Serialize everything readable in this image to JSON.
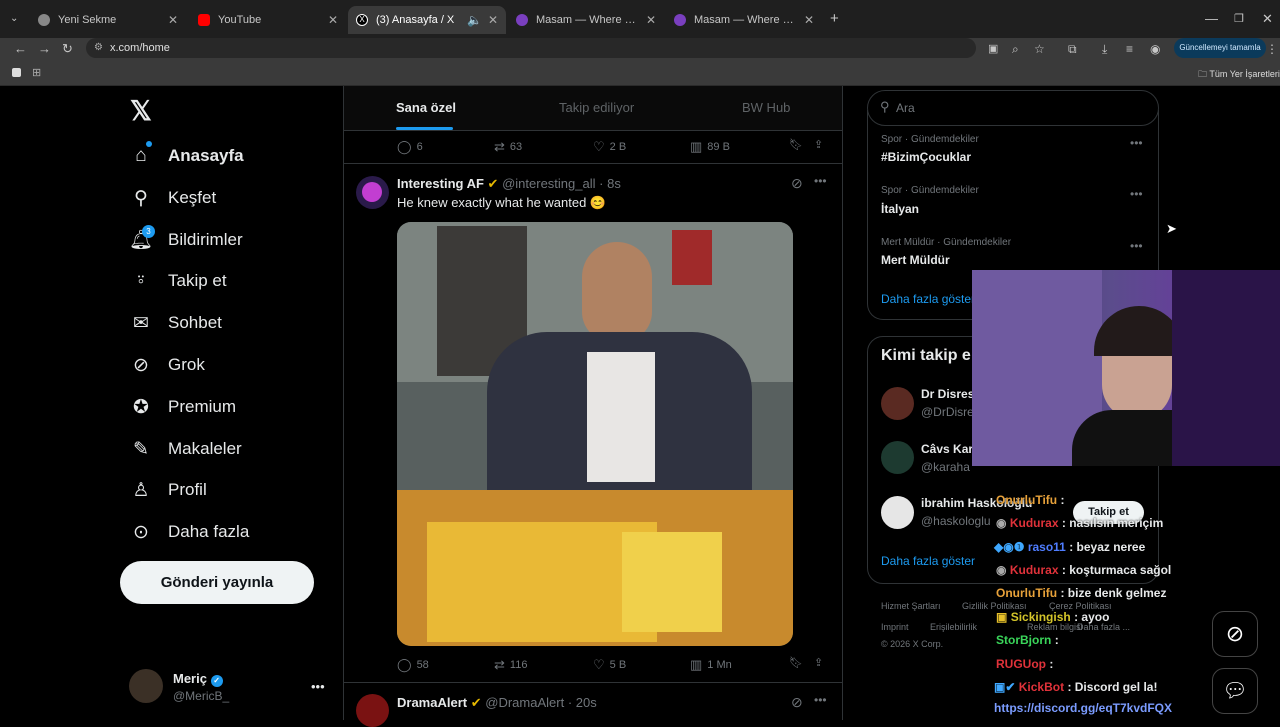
{
  "browser": {
    "tabs": [
      {
        "title": "Yeni Sekme"
      },
      {
        "title": "YouTube"
      },
      {
        "title": "(3) Anasayfa / X"
      },
      {
        "title": "Masam — Where Setups Come..."
      },
      {
        "title": "Masam — Where Setups Come..."
      }
    ],
    "url": "x.com/home",
    "update_label": "Güncellemeyi tamamla",
    "bookmarks_label": "Tüm Yer İşaretleri"
  },
  "nav": {
    "items": [
      {
        "label": "Anasayfa",
        "icon": "home-icon"
      },
      {
        "label": "Keşfet",
        "icon": "search-icon"
      },
      {
        "label": "Bildirimler",
        "icon": "bell-icon"
      },
      {
        "label": "Takip et",
        "icon": "person-add-icon"
      },
      {
        "label": "Sohbet",
        "icon": "mail-icon"
      },
      {
        "label": "Grok",
        "icon": "grok-icon"
      },
      {
        "label": "Premium",
        "icon": "verified-icon"
      },
      {
        "label": "Makaleler",
        "icon": "article-icon"
      },
      {
        "label": "Profil",
        "icon": "profile-icon"
      },
      {
        "label": "Daha fazla",
        "icon": "more-circle-icon"
      }
    ],
    "notif_count": "3",
    "post_label": "Gönderi yayınla",
    "user": {
      "name": "Meriç",
      "handle": "@MericB_"
    }
  },
  "feed": {
    "tabs": [
      "Sana özel",
      "Takip ediliyor",
      "BW Hub"
    ],
    "top_actions": {
      "replies": "6",
      "reposts": "63",
      "likes": "2 B",
      "views": "89 B"
    },
    "post": {
      "author": "Interesting AF",
      "handle": "@interesting_all",
      "time": "8s",
      "text": "He knew exactly what he wanted 😊",
      "replies": "58",
      "reposts": "116",
      "likes": "5 B",
      "views": "1 Mn"
    },
    "next_post": {
      "author": "DramaAlert",
      "handle": "@DramaAlert",
      "time": "20s"
    }
  },
  "right": {
    "search_placeholder": "Ara",
    "trends": [
      {
        "meta": "Spor · Gündemdekiler",
        "name": "#BizimÇocuklar"
      },
      {
        "meta": "Spor · Gündemdekiler",
        "name": "İtalyan"
      },
      {
        "meta": "Mert Müldür · Gündemdekiler",
        "name": "Mert Müldür"
      }
    ],
    "show_more": "Daha fazla göster",
    "who_to_follow_title": "Kimi takip e",
    "follow": [
      {
        "name": "Dr Disres",
        "handle": "@DrDisre"
      },
      {
        "name": "Câvs Kar",
        "handle": "@karaha"
      },
      {
        "name": "ibrahim Haskoloğlu",
        "handle": "@haskologlu"
      }
    ],
    "follow_button": "Takip et",
    "show_more_2": "Daha fazla göster",
    "footer": [
      "Hizmet Şartları",
      "Gizlilik Politikası",
      "Çerez Politikası",
      "Imprint",
      "Erişilebilirlik",
      "Reklam bilgisi",
      "Daha fazla ...",
      "© 2026 X Corp."
    ]
  },
  "chat": [
    {
      "user": "OnurluTifu",
      "msg": ":",
      "color": "#e8a23a"
    },
    {
      "user": "Kudurax",
      "msg": ": nasılsın meriçim",
      "color": "#e0323a"
    },
    {
      "user": "raso11",
      "msg": ": beyaz neree",
      "color": "#4f7dff"
    },
    {
      "user": "Kudurax",
      "msg": ": koşturmaca sağol",
      "color": "#e0323a"
    },
    {
      "user": "OnurluTifu",
      "msg": ": bize denk gelmez",
      "color": "#e8a23a"
    },
    {
      "user": "Sickingish",
      "msg": ": ayoo",
      "color": "#d4c52a"
    },
    {
      "user": "StorBjorn",
      "msg": ":",
      "color": "#3ad65a"
    },
    {
      "user": "RUGUop",
      "msg": ":",
      "color": "#e0323a"
    },
    {
      "user": "KickBot",
      "msg": ": Discord gel la!",
      "color": "#e0323a"
    },
    {
      "user": "",
      "msg": "https://discord.gg/eqT7kvdFQX",
      "color": "#7b9cff"
    }
  ]
}
